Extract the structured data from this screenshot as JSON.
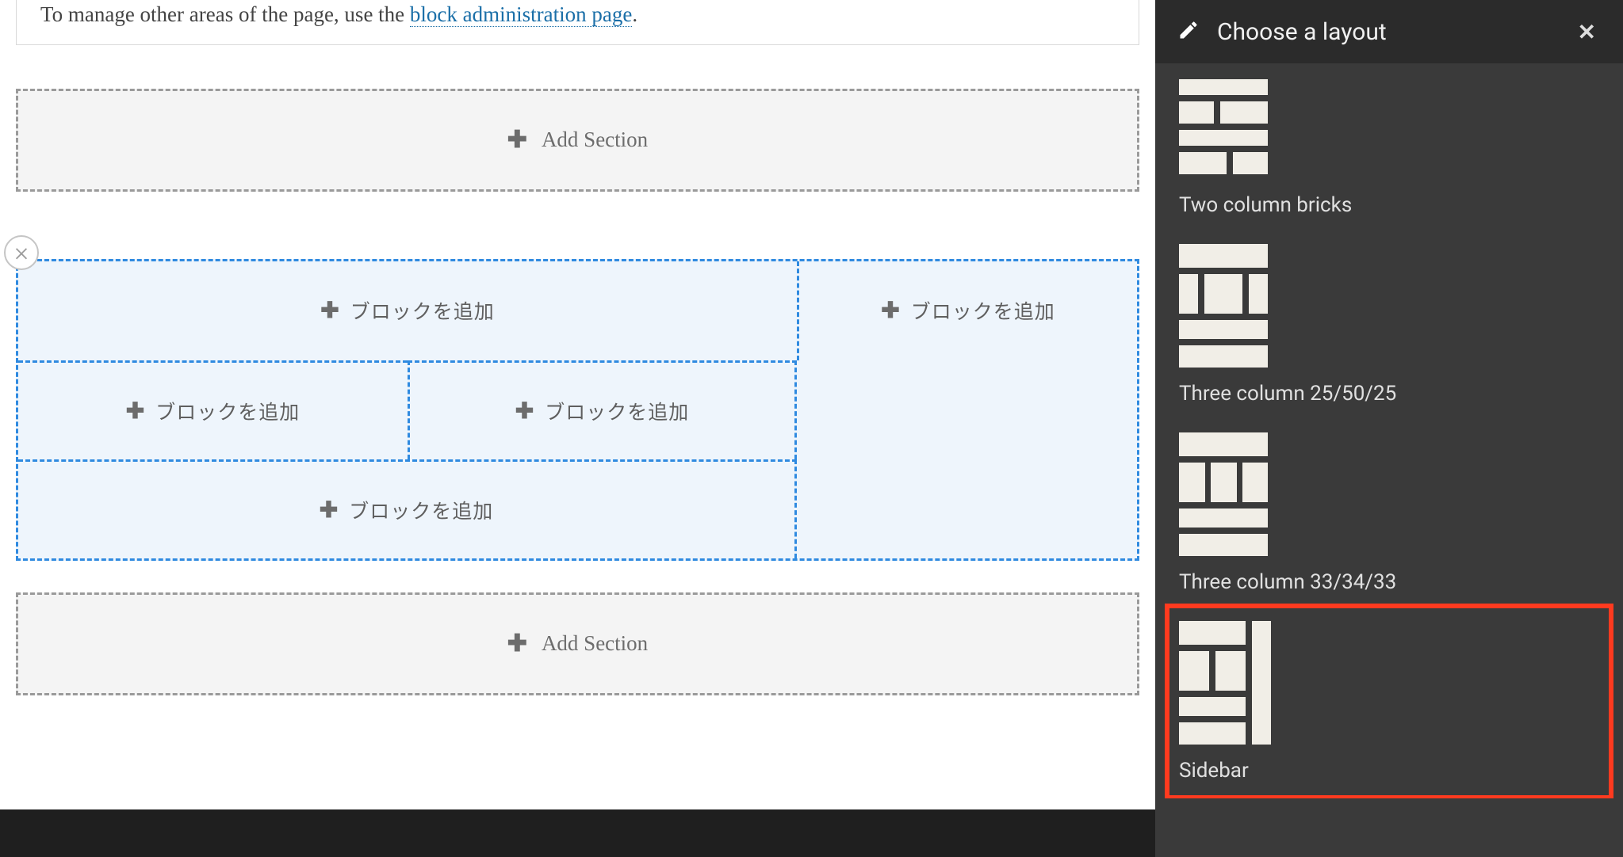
{
  "info": {
    "text_prefix": "To manage other areas of the page, use the ",
    "link_text": "block administration page",
    "text_suffix": "."
  },
  "add_section_label": "Add Section",
  "add_block_label": "ブロックを追加",
  "sidebar": {
    "title": "Choose a layout",
    "layouts": [
      {
        "id": "two-col-bricks",
        "label": "Two column bricks"
      },
      {
        "id": "three-25-50-25",
        "label": "Three column 25/50/25"
      },
      {
        "id": "three-33-34-33",
        "label": "Three column 33/34/33"
      },
      {
        "id": "sidebar-layout",
        "label": "Sidebar"
      }
    ],
    "selected": "sidebar-layout"
  }
}
